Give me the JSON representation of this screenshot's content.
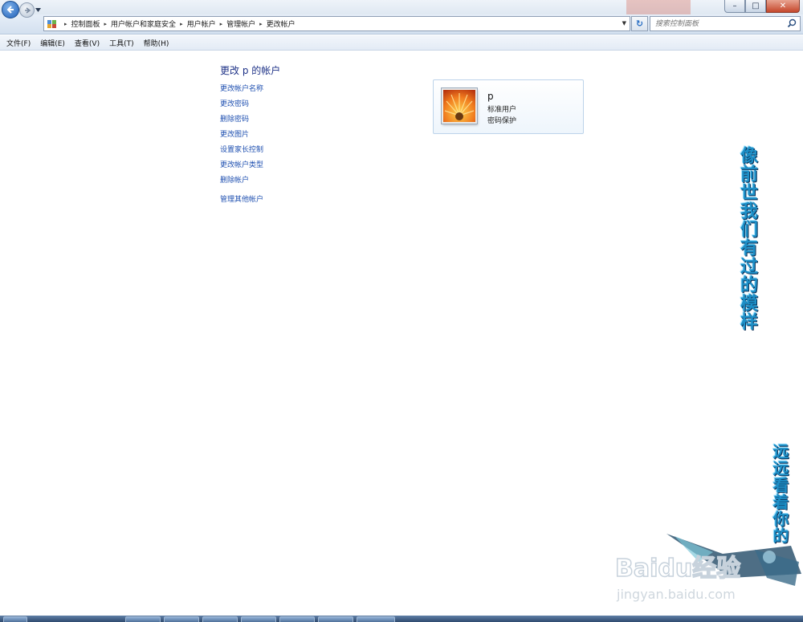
{
  "window": {
    "minimize_glyph": "–",
    "maximize_glyph": "□",
    "close_glyph": "✕"
  },
  "navigation": {
    "back_icon": "back-arrow-icon",
    "forward_icon": "forward-arrow-icon",
    "history_icon": "chevron-down-icon"
  },
  "address": {
    "icon": "control-panel-icon",
    "breadcrumbs": [
      "控制面板",
      "用户帐户和家庭安全",
      "用户帐户",
      "管理帐户",
      "更改帐户"
    ],
    "separator": "▸",
    "dropdown_glyph": "▼",
    "refresh_glyph": "↻"
  },
  "search": {
    "placeholder": "搜索控制面板",
    "icon": "search-icon"
  },
  "menu": {
    "file": "文件(F)",
    "edit": "编辑(E)",
    "view": "查看(V)",
    "tools": "工具(T)",
    "help": "帮助(H)"
  },
  "page": {
    "heading": "更改 p 的帐户",
    "links": {
      "rename": "更改帐户名称",
      "password": "更改密码",
      "delete_password": "删除密码",
      "picture": "更改图片",
      "parental": "设置家长控制",
      "type": "更改帐户类型",
      "delete_account": "删除帐户",
      "manage_other": "管理其他帐户"
    }
  },
  "account": {
    "name": "p",
    "type": "标准用户",
    "protection": "密码保护",
    "picture_icon": "flower-picture-icon"
  },
  "watermark": {
    "text_one": "像前世我们有过的模样",
    "text_two": "远远看着你的",
    "logo_text": "Baidu经验",
    "logo_url": "jingyan.baidu.com"
  },
  "colors": {
    "link": "#1e4fb0",
    "heading": "#1e3287",
    "watermark": "#1d8fc7"
  }
}
